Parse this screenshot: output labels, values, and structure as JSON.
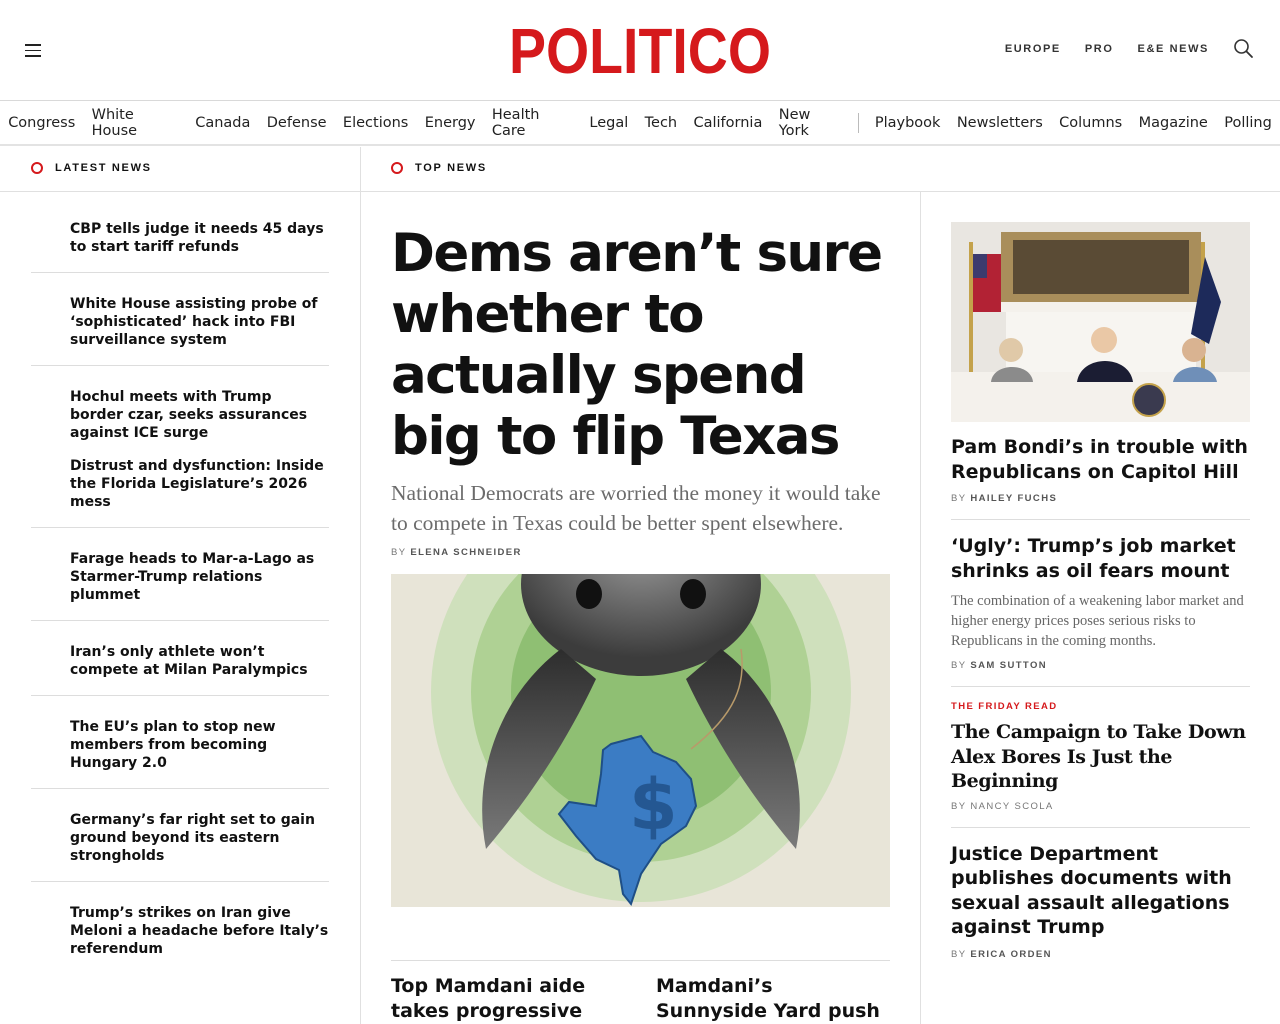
{
  "brand": {
    "logo_text": "POLITICO",
    "brand_color": "#d5191c"
  },
  "header": {
    "links": [
      "EUROPE",
      "PRO",
      "E&E NEWS"
    ],
    "menu_icon": "hamburger-menu-icon",
    "search_icon": "search-icon"
  },
  "nav": {
    "primary": [
      "Congress",
      "White House",
      "Canada",
      "Defense",
      "Elections",
      "Energy",
      "Health Care",
      "Legal",
      "Tech",
      "California",
      "New York"
    ],
    "secondary": [
      "Playbook",
      "Newsletters",
      "Columns",
      "Magazine",
      "Polling"
    ]
  },
  "sections": {
    "latest_label": "LATEST NEWS",
    "top_label": "TOP NEWS"
  },
  "latest_news": [
    "CBP tells judge it needs 45 days to start tariff refunds",
    "White House assisting probe of ‘sophisticated’ hack into FBI surveillance system",
    "Hochul meets with Trump border czar, seeks assurances against ICE surge",
    "Distrust and dysfunction: Inside the Florida Legislature’s 2026 mess",
    "Farage heads to Mar-a-Lago as Starmer-Trump relations plummet",
    "Iran’s only athlete won’t compete at Milan Paralympics",
    "The EU’s plan to stop new members from becoming Hungary 2.0",
    "Germany’s far right set to gain ground beyond its eastern strongholds",
    "Trump’s strikes on Iran give Meloni a headache before Italy’s referendum"
  ],
  "lead": {
    "headline": "Dems aren’t sure whether to actually spend big to flip Texas",
    "dek": "National Democrats are worried the money it would take to compete in Texas could be better spent elsewhere.",
    "by": "BY",
    "author": "ELENA SCHNEIDER"
  },
  "sub_stories": [
    "Top Mamdani aide takes progressive project to the",
    "Mamdani’s Sunnyside Yard push illustrates shift"
  ],
  "right": [
    {
      "headline": "Pam Bondi’s in trouble with Republicans on Capitol Hill",
      "by": "BY",
      "author": "HAILEY FUCHS"
    },
    {
      "headline": "‘Ugly’: Trump’s job market shrinks as oil fears mount",
      "dek": "The combination of a weakening labor market and higher energy prices poses serious risks to Republicans in the coming months.",
      "by": "BY",
      "author": "SAM SUTTON"
    },
    {
      "kicker": "THE FRIDAY READ",
      "headline": "The Campaign to Take Down Alex Bores Is Just the Beginning",
      "byline": "BY NANCY SCOLA"
    },
    {
      "headline": "Justice Department publishes documents with sexual assault allegations against Trump",
      "by": "BY",
      "author": "ERICA ORDEN"
    }
  ]
}
